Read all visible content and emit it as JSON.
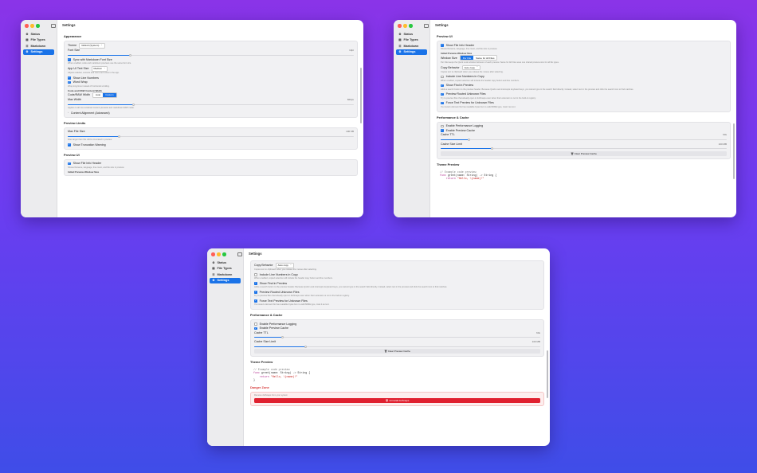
{
  "sidebar": {
    "items": [
      {
        "label": "Status",
        "icon": "⚙"
      },
      {
        "label": "File Types",
        "icon": "▤"
      },
      {
        "label": "Markdown",
        "icon": "☰"
      },
      {
        "label": "Settings",
        "icon": "⚙"
      }
    ]
  },
  "window_title": "Settings",
  "appearance": {
    "header": "Appearance",
    "theme_label": "Theme",
    "theme_value": "GitHub (System)",
    "font_size_label": "Font Size",
    "font_size_value": "13pt",
    "font_size_level": 0.22,
    "sync_label": "Sync with Markdown Font Size",
    "sync_desc": "When enabled, code and markdown previews use the same font size.",
    "app_ui_label": "App UI Text Size",
    "app_ui_value": "Medium",
    "app_ui_desc": "Adjusts sidebar, controls and menu text sizes in the app.",
    "line_numbers_label": "Show Line Numbers",
    "word_wrap_label": "Word Wrap",
    "word_wrap_desc": "Wrap long lines instead of horizontal scrolling.",
    "code_width_header": "Code and RAW Content Width",
    "code_width_label": "Code/RAW Width",
    "code_width_options": [
      "Auto",
      "Custom"
    ],
    "max_width_label": "Max Width",
    "max_width_value": "820px",
    "max_width_level": 0.23,
    "max_width_desc": "Applies to all non-rendered content previews and markdown RAW mode.",
    "content_alignment": "Content Alignment (Advanced)"
  },
  "preview_limits": {
    "header": "Preview Limits",
    "max_file_label": "Max File Size",
    "max_file_value": "100 KB",
    "max_file_level": 0.18,
    "max_file_desc": "Files larger than this will be truncated in preview.",
    "truncation_label": "Show Truncation Warning"
  },
  "preview_ui": {
    "header": "Preview UI",
    "show_file_info_label": "Show File Info Header",
    "show_file_info_desc": "Shows filename, language, line count, and file size in preview.",
    "initial_size_header": "Initial Preview Window Size",
    "window_size_label": "Window Size",
    "window_size_options": [
      "Per File",
      "Same for All Files"
    ],
    "window_size_desc": "Per File keeps the Quick Look window behavior of each preview. Same for All Files uses one shared preview size for all file types.",
    "copy_behavior_label": "Copy Behavior",
    "copy_behavior_value": "Auto copy",
    "copy_behavior_desc": "Copies text to clipboard when you release the mouse after selecting.",
    "include_line_numbers_label": "Include Line Numbers in Copy",
    "include_line_numbers_desc": "When enabled, copied selection will include the header copy button and line numbers.",
    "show_find_label": "Show Find in Preview",
    "show_find_desc": "Adds a search button to the preview header. Because Quick Look intercepts keyboard keys, you cannot type in the search field directly. Instead, select text in the preview and click the search icon to find matches.",
    "routed_label": "Preview Routed Unknown Files",
    "routed_desc": "Try to preview files that already open in dotSnaps even when their extension is not in the built-in registry.",
    "force_text_label": "Force Text Preview for Unknown Files",
    "force_text_desc": "If a routed unknown file has readable bytes but no valid MIME type, treat it as text."
  },
  "performance": {
    "header": "Performance & Cache",
    "logging_label": "Enable Performance Logging",
    "cache_label": "Enable Preview Cache",
    "ttl_label": "Cache TTL",
    "ttl_value": "60s",
    "ttl_level": 0.1,
    "size_label": "Cache Size Limit",
    "size_value": "100 MB",
    "size_level": 0.18,
    "clear_label": "Clear Preview Cache",
    "clear_icon": "trash-icon"
  },
  "theme_preview": {
    "header": "Theme Preview",
    "line1": "// Example code preview",
    "line2_kw": "func",
    "line2_rest": " greet(name: String) -> String {",
    "line3_kw": "    return",
    "line3_str": " \"Hello, \\(name)!\"",
    "line4": "}"
  },
  "danger": {
    "header": "Danger Zone",
    "desc": "Remove dotSnaps from your system",
    "button": "Uninstall dotSnaps",
    "color": "#e0202f"
  },
  "colors": {
    "accent": "#1a73e8"
  }
}
